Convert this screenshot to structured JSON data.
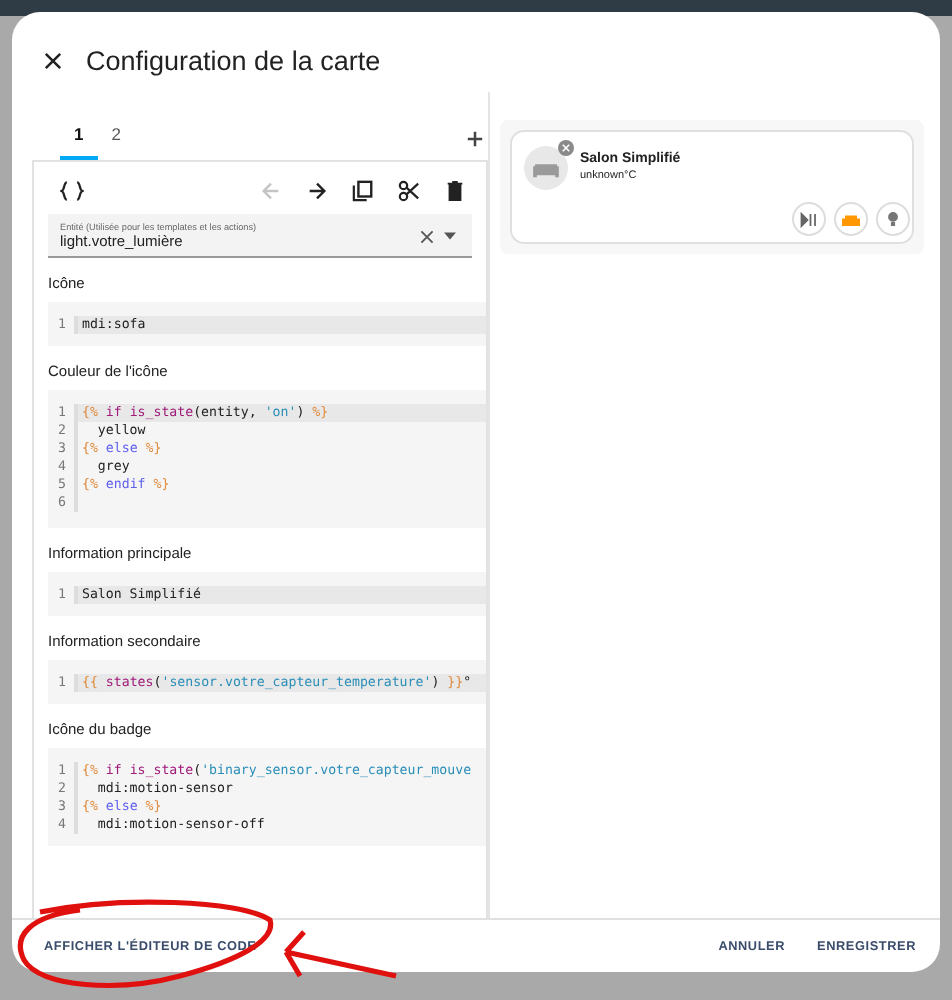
{
  "dialog": {
    "title": "Configuration de la carte"
  },
  "tabs": [
    {
      "label": "1",
      "selected": true
    },
    {
      "label": "2",
      "selected": false
    }
  ],
  "toolbar": {
    "back_disabled": true
  },
  "entity": {
    "label": "Entité (Utilisée pour les templates et les actions)",
    "value": "light.votre_lumière"
  },
  "fields": [
    {
      "label": "Icône",
      "lines": [
        {
          "number": "1",
          "active": true,
          "tokens": [
            {
              "kind": "plain",
              "text": "mdi:sofa"
            }
          ]
        }
      ]
    },
    {
      "label": "Couleur de l'icône",
      "lines": [
        {
          "number": "1",
          "active": true,
          "tokens": [
            {
              "kind": "delim",
              "text": "{%"
            },
            {
              "kind": "call",
              "text": " if is_state"
            },
            {
              "kind": "plain",
              "text": "(entity, "
            },
            {
              "kind": "string",
              "text": "'on'"
            },
            {
              "kind": "plain",
              "text": ") "
            },
            {
              "kind": "delim",
              "text": "%}"
            }
          ]
        },
        {
          "number": "2",
          "active": false,
          "tokens": [
            {
              "kind": "plain",
              "text": "  yellow"
            }
          ]
        },
        {
          "number": "3",
          "active": false,
          "tokens": [
            {
              "kind": "delim",
              "text": "{%"
            },
            {
              "kind": "keyword",
              "text": " else "
            },
            {
              "kind": "delim",
              "text": "%}"
            }
          ]
        },
        {
          "number": "4",
          "active": false,
          "tokens": [
            {
              "kind": "plain",
              "text": "  grey"
            }
          ]
        },
        {
          "number": "5",
          "active": false,
          "tokens": [
            {
              "kind": "delim",
              "text": "{%"
            },
            {
              "kind": "keyword",
              "text": " endif "
            },
            {
              "kind": "delim",
              "text": "%}"
            }
          ]
        },
        {
          "number": "6",
          "active": false
        }
      ]
    },
    {
      "label": "Information principale",
      "lines": [
        {
          "number": "1",
          "active": true,
          "tokens": [
            {
              "kind": "plain",
              "text": "Salon Simplifié"
            }
          ]
        }
      ]
    },
    {
      "label": "Information secondaire",
      "lines": [
        {
          "number": "1",
          "active": true,
          "tokens": [
            {
              "kind": "delim",
              "text": "{{"
            },
            {
              "kind": "call",
              "text": " states"
            },
            {
              "kind": "plain",
              "text": "("
            },
            {
              "kind": "string",
              "text": "'sensor.votre_capteur_temperature'"
            },
            {
              "kind": "plain",
              "text": ") "
            },
            {
              "kind": "delim",
              "text": "}}"
            },
            {
              "kind": "plain",
              "text": "°"
            }
          ]
        }
      ]
    },
    {
      "label": "Icône du badge",
      "lines": [
        {
          "number": "1",
          "active": false,
          "tokens": [
            {
              "kind": "delim",
              "text": "{%"
            },
            {
              "kind": "call",
              "text": " if is_state"
            },
            {
              "kind": "plain",
              "text": "("
            },
            {
              "kind": "string",
              "text": "'binary_sensor.votre_capteur_mouve"
            }
          ]
        },
        {
          "number": "2",
          "active": false,
          "tokens": [
            {
              "kind": "plain",
              "text": "  mdi:motion-sensor"
            }
          ]
        },
        {
          "number": "3",
          "active": false,
          "tokens": [
            {
              "kind": "delim",
              "text": "{%"
            },
            {
              "kind": "keyword",
              "text": " else "
            },
            {
              "kind": "delim",
              "text": "%}"
            }
          ]
        },
        {
          "number": "4",
          "active": false,
          "tokens": [
            {
              "kind": "plain",
              "text": "  mdi:motion-sensor-off"
            }
          ]
        }
      ]
    }
  ],
  "preview": {
    "name": "Salon Simplifié",
    "state": "unknown°C",
    "buttons": [
      {
        "kind": "play-pause",
        "on": false
      },
      {
        "kind": "sofa",
        "on": true
      },
      {
        "kind": "bulb",
        "on": false
      }
    ]
  },
  "footer": {
    "code_button": "AFFICHER L'ÉDITEUR DE CODE",
    "actions": [
      "ANNULER",
      "ENREGISTRER"
    ]
  }
}
